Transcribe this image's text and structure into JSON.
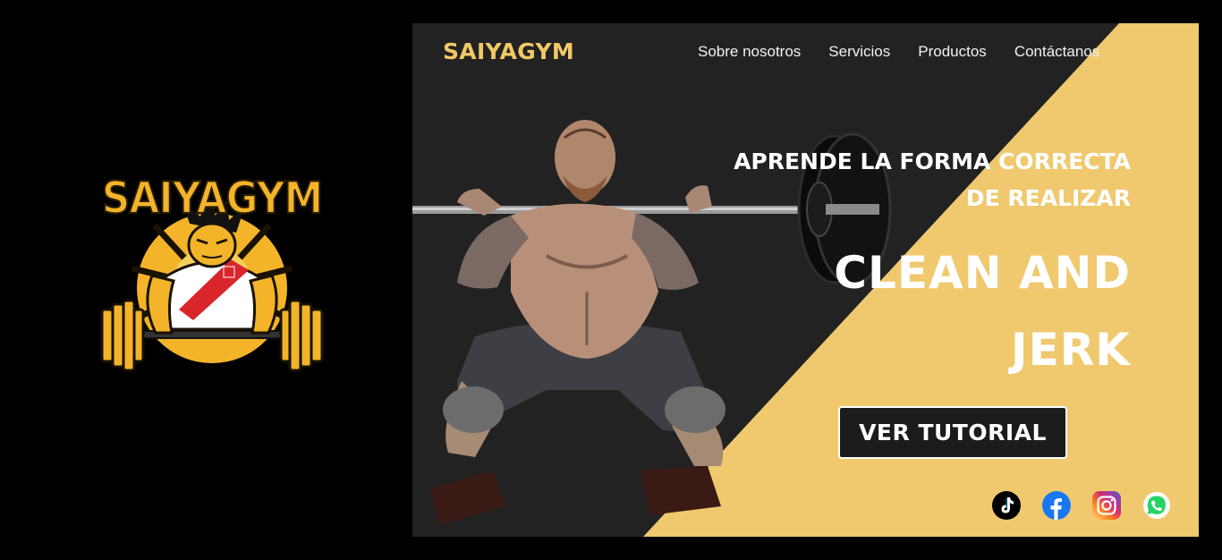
{
  "logo": {
    "text": "SAIYAGYM",
    "icon": "saiyagym-logo-icon"
  },
  "site": {
    "brand": "SAIYAGYM",
    "nav": [
      {
        "label": "Sobre nosotros"
      },
      {
        "label": "Servicios"
      },
      {
        "label": "Productos"
      },
      {
        "label": "Contáctanos"
      }
    ],
    "hero": {
      "subtitle_line1": "APRENDE LA FORMA CORRECTA",
      "subtitle_line2": "DE REALIZAR",
      "title_line1": "CLEAN AND",
      "title_line2": "JERK",
      "cta": "VER TUTORIAL"
    },
    "socials": [
      {
        "icon": "tiktok-icon"
      },
      {
        "icon": "facebook-icon"
      },
      {
        "icon": "instagram-icon"
      },
      {
        "icon": "whatsapp-icon"
      }
    ]
  },
  "colors": {
    "background": "#000000",
    "site_dark": "#222222",
    "accent_yellow": "#f0c96f",
    "brand_yellow": "#f0c865",
    "logo_orange": "#f3b42a"
  }
}
